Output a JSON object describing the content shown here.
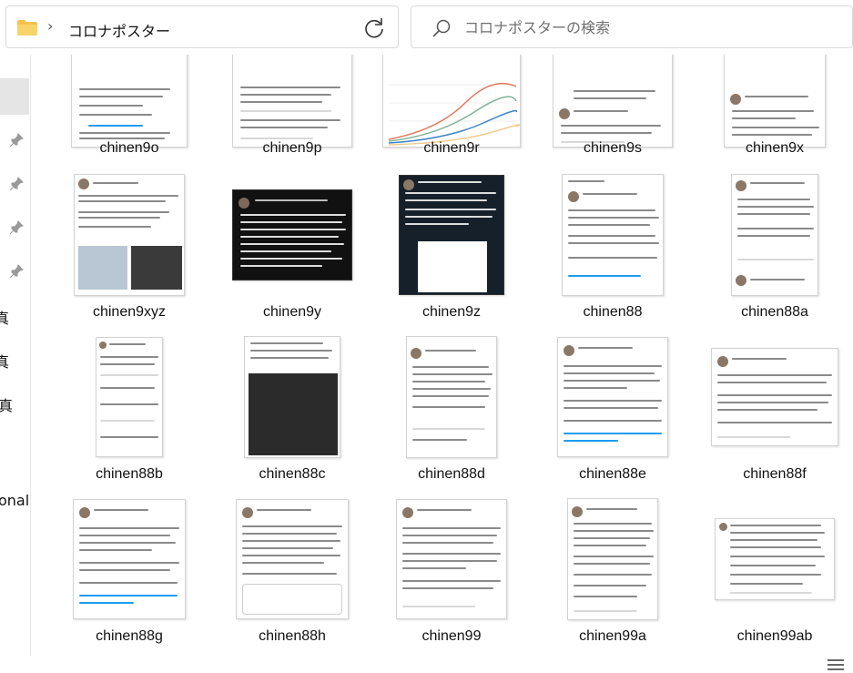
{
  "address": {
    "breadcrumb_separator": "›",
    "folder": "コロナポスター"
  },
  "search": {
    "placeholder": "コロナポスターの検索"
  },
  "nav": {
    "partial_labels": [
      "真",
      "真",
      "真",
      "onal"
    ]
  },
  "files": [
    {
      "name": "chinen9o"
    },
    {
      "name": "chinen9p"
    },
    {
      "name": "chinen9r"
    },
    {
      "name": "chinen9s"
    },
    {
      "name": "chinen9x"
    },
    {
      "name": "chinen9xyz"
    },
    {
      "name": "chinen9y"
    },
    {
      "name": "chinen9z"
    },
    {
      "name": "chinen88"
    },
    {
      "name": "chinen88a"
    },
    {
      "name": "chinen88b"
    },
    {
      "name": "chinen88c"
    },
    {
      "name": "chinen88d"
    },
    {
      "name": "chinen88e"
    },
    {
      "name": "chinen88f"
    },
    {
      "name": "chinen88g"
    },
    {
      "name": "chinen88h"
    },
    {
      "name": "chinen99"
    },
    {
      "name": "chinen99a"
    },
    {
      "name": "chinen99ab"
    }
  ],
  "colors": {
    "accent": "#1d9bf0",
    "folder": "#f2c14e"
  }
}
